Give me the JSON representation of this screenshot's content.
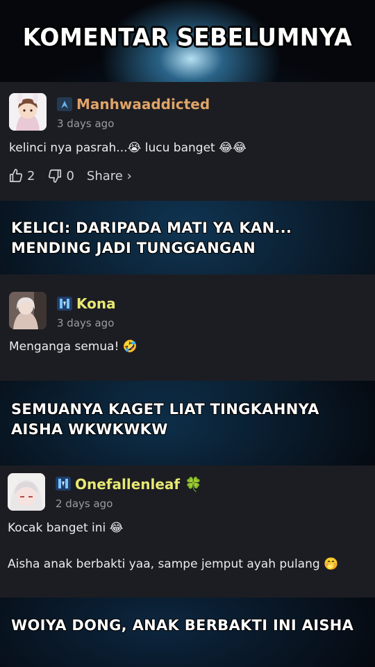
{
  "header": {
    "title": "KOMENTAR SEBELUMNYA"
  },
  "comments": [
    {
      "username": "Manhwaaddicted",
      "date": "3 days ago",
      "text": "kelinci nya pasrah...😭 lucu banget 😂😂",
      "likes": "2",
      "dislikes": "0",
      "share_label": "Share ›",
      "username_color": "#e0a468"
    },
    {
      "username": "Kona",
      "date": "3 days ago",
      "text": "Menganga semua! 🤣",
      "username_color": "#e7e873"
    },
    {
      "username": "Onefallenleaf 🍀",
      "date": "2 days ago",
      "text_line1": "Kocak banget ini 😂",
      "text_line2": "Aisha anak berbakti yaa, sampe jemput ayah pulang 🤭",
      "username_color": "#e7e873"
    }
  ],
  "captions": [
    {
      "line1": "KELICI: DARIPADA MATI YA KAN...",
      "line2": "MENDING JADI TUNGGANGAN"
    },
    {
      "line1": "SEMUANYA KAGET LIAT TINGKAHNYA",
      "line2": "AISHA WKWKWKW"
    },
    {
      "line1": "WOIYA DONG, ANAK BERBAKTI INI AISHA"
    }
  ],
  "icons": {
    "like": "thumbs-up-icon",
    "dislike": "thumbs-down-icon",
    "badge": "rank-badge-icon"
  }
}
